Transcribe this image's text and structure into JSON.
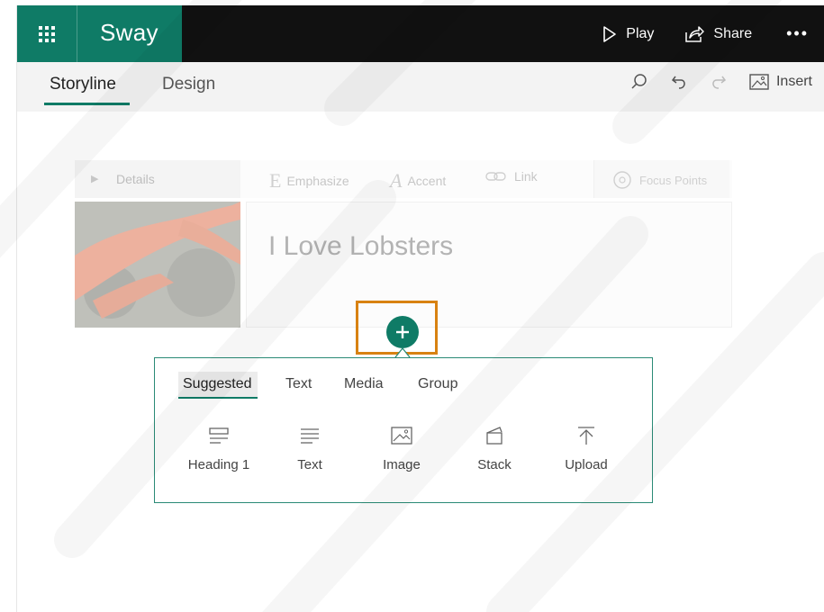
{
  "app": {
    "name": "Sway",
    "play_label": "Play",
    "share_label": "Share",
    "more_label": "•••"
  },
  "tabs": [
    {
      "label": "Storyline",
      "active": true
    },
    {
      "label": "Design",
      "active": false
    }
  ],
  "toolbar": {
    "insert_label": "Insert"
  },
  "card": {
    "details_label": "Details",
    "emphasize_label": "Emphasize",
    "accent_label": "Accent",
    "link_label": "Link",
    "focus_points_label": "Focus Points",
    "title": "I Love Lobsters"
  },
  "insert_panel": {
    "tabs": [
      {
        "label": "Suggested",
        "active": true
      },
      {
        "label": "Text",
        "active": false
      },
      {
        "label": "Media",
        "active": false
      },
      {
        "label": "Group",
        "active": false
      }
    ],
    "items": [
      {
        "label": "Heading 1",
        "icon": "heading-icon"
      },
      {
        "label": "Text",
        "icon": "text-icon"
      },
      {
        "label": "Image",
        "icon": "image-icon"
      },
      {
        "label": "Stack",
        "icon": "stack-icon"
      },
      {
        "label": "Upload",
        "icon": "upload-icon"
      }
    ]
  },
  "colors": {
    "brand": "#0f7b66",
    "topbar": "#111111",
    "highlight": "#d88212"
  }
}
